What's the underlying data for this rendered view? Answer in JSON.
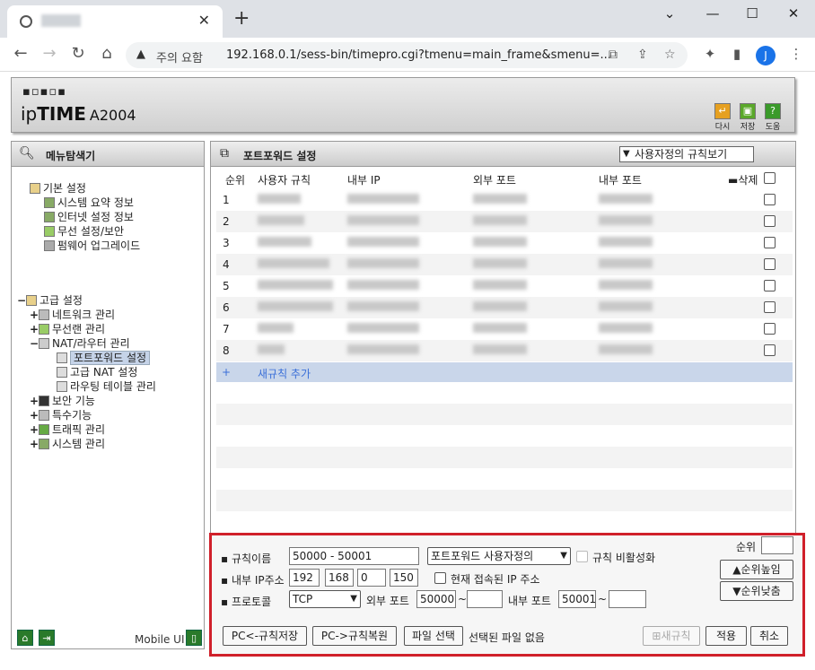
{
  "browser": {
    "new_tab": "+",
    "close_tab": "✕",
    "minimize": "⌄",
    "restore": "—",
    "maximize": "☐",
    "close": "✕",
    "security_label": "주의 요함",
    "url": "192.168.0.1/sess-bin/timepro.cgi?tmenu=main_frame&smenu=...",
    "avatar": "J"
  },
  "router": {
    "dots": "▪▫▪▫▪",
    "brand_ip": "ip",
    "brand_time": "TIME",
    "model": "A2004",
    "toolbar": [
      {
        "label": "다시",
        "color": "#e6a020",
        "icon": "↵"
      },
      {
        "label": "저장",
        "color": "#5aa82a",
        "icon": "▣"
      },
      {
        "label": "도움",
        "color": "#3a9a2a",
        "icon": "?"
      }
    ]
  },
  "menu": {
    "title": "메뉴탐색기",
    "basic": {
      "label": "기본 설정",
      "items": [
        "시스템 요약 정보",
        "인터넷 설정 정보",
        "무선 설정/보안",
        "펌웨어 업그레이드"
      ]
    },
    "advanced": {
      "label": "고급 설정",
      "pm": "−"
    },
    "advanced_items": [
      {
        "pm": "+",
        "label": "네트워크 관리"
      },
      {
        "pm": "+",
        "label": "무선랜 관리"
      },
      {
        "pm": "−",
        "label": "NAT/라우터 관리"
      }
    ],
    "nat_items": [
      "포트포워드 설정",
      "고급 NAT 설정",
      "라우팅 테이블 관리"
    ],
    "more_items": [
      {
        "pm": "+",
        "label": "보안 기능"
      },
      {
        "pm": "+",
        "label": "특수기능"
      },
      {
        "pm": "+",
        "label": "트래픽 관리"
      },
      {
        "pm": "+",
        "label": "시스템 관리"
      }
    ],
    "mobile": "Mobile UI"
  },
  "portforward": {
    "title": "포트포워드 설정",
    "view_select": "사용자정의 규칙보기",
    "headers": {
      "no": "순위",
      "rule": "사용자 규칙",
      "internal_ip": "내부 IP",
      "external_port": "외부 포트",
      "internal_port": "내부 포트",
      "delete": "삭제"
    },
    "rows": [
      "1",
      "2",
      "3",
      "4",
      "5",
      "6",
      "7",
      "8"
    ],
    "add_plus": "+",
    "add_rule": "새규칙 추가"
  },
  "form": {
    "rule_name_label": "규칙이름",
    "rule_name": "50000 - 50001",
    "rule_type": "포트포워드 사용자정의",
    "disable_label": "규칙 비활성화",
    "ip_label": "내부 IP주소",
    "ip": [
      "192",
      "168",
      "0",
      "150"
    ],
    "current_ip_label": "현재 접속된 IP 주소",
    "protocol_label": "프로토콜",
    "protocol": "TCP",
    "ext_port_label": "외부 포트",
    "ext_port_from": "50000",
    "ext_port_to": "",
    "int_port_label": "내부 포트",
    "int_port_from": "50001",
    "int_port_to": "",
    "tilde": "~",
    "order_label": "순위",
    "order_value": "",
    "order_up": "▲순위높임",
    "order_down": "▼순위낮춤",
    "pc_save": "PC<-규칙저장",
    "pc_restore": "PC->규칙복원",
    "file_select": "파일 선택",
    "no_file": "선택된 파일 없음",
    "new_rule": "새규칙",
    "apply": "적용",
    "cancel": "취소"
  }
}
